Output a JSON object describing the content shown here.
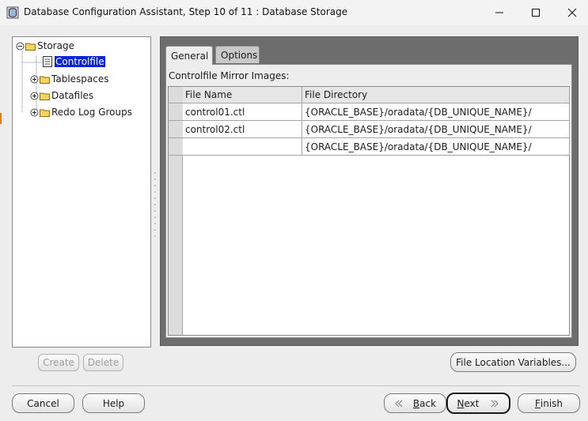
{
  "window": {
    "title": "Database Configuration Assistant, Step 10 of 11 : Database Storage"
  },
  "tree": {
    "root": "Storage",
    "items": [
      {
        "label": "Controlfile",
        "selected": true
      },
      {
        "label": "Tablespaces"
      },
      {
        "label": "Datafiles"
      },
      {
        "label": "Redo Log Groups"
      }
    ]
  },
  "tabs": [
    {
      "label": "General",
      "active": true
    },
    {
      "label": "Options",
      "active": false
    }
  ],
  "general": {
    "section_label": "Controlfile Mirror Images:",
    "columns": [
      "File Name",
      "File Directory"
    ],
    "rows": [
      {
        "file_name": "control01.ctl",
        "file_directory": "{ORACLE_BASE}/oradata/{DB_UNIQUE_NAME}/"
      },
      {
        "file_name": "control02.ctl",
        "file_directory": "{ORACLE_BASE}/oradata/{DB_UNIQUE_NAME}/"
      },
      {
        "file_name": "",
        "file_directory": "{ORACLE_BASE}/oradata/{DB_UNIQUE_NAME}/"
      }
    ]
  },
  "buttons": {
    "create": "Create",
    "delete": "Delete",
    "file_location_variables": "File Location Variables...",
    "cancel": "Cancel",
    "help": "Help",
    "back_mnemonic": "B",
    "back_rest": "ack",
    "next_mnemonic": "N",
    "next_rest": "ext",
    "finish_mnemonic": "F",
    "finish_rest": "inish"
  },
  "colors": {
    "selection": "#0a24d8",
    "frame_dark": "#6d6d6d",
    "background": "#ededed"
  }
}
